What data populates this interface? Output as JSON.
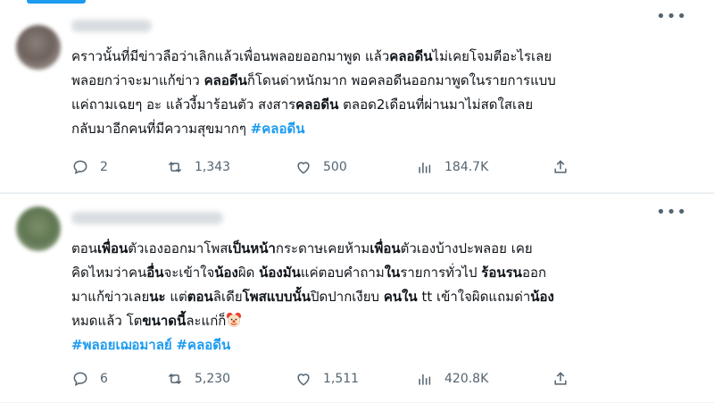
{
  "tweets": [
    {
      "text_lines": [
        [
          {
            "t": "คราวนั้นที่มีข่าวลือว่าเลิกแล้วเพื่อนพลอยออกมาพูด แล้ว"
          },
          {
            "t": "คลอดีน",
            "b": true
          },
          {
            "t": "ไม่เคยโจมตีอะไรเลย"
          }
        ],
        [
          {
            "t": "พลอยกว่าจะมาแก้ข่าว "
          },
          {
            "t": "คลอดีน",
            "b": true
          },
          {
            "t": "ก็โดนด่าหนักมาก พอคลอดีนออกมาพูดในรายการแบบ"
          }
        ],
        [
          {
            "t": "แค่ถามเฉยๆ อะ แล้วงี้มาร้อนตัว สงสาร"
          },
          {
            "t": "คลอดีน",
            "b": true
          },
          {
            "t": " ตลอด2เดือนที่ผ่านมาไม่สดใสเลย"
          }
        ],
        [
          {
            "t": "กลับมาอีกคนที่มีความสุขมากๆ "
          },
          {
            "t": "#คลอดีน",
            "h": true
          }
        ]
      ],
      "replies": "2",
      "retweets": "1,343",
      "likes": "500",
      "views": "184.7K"
    },
    {
      "text_lines": [
        [
          {
            "t": "ตอน"
          },
          {
            "t": "เพื่อน",
            "b": true
          },
          {
            "t": "ตัวเองออกมาโพส"
          },
          {
            "t": "เป็นหน้า",
            "b": true
          },
          {
            "t": "กระดาษเคยห้าม"
          },
          {
            "t": "เพื่อน",
            "b": true
          },
          {
            "t": "ตัวเองบ้างปะพลอย เคย"
          }
        ],
        [
          {
            "t": "คิดไหมว่าคน"
          },
          {
            "t": "อื่น",
            "b": true
          },
          {
            "t": "จะเข้าใจ"
          },
          {
            "t": "น้อง",
            "b": true
          },
          {
            "t": "ผิด "
          },
          {
            "t": "น้องมัน",
            "b": true
          },
          {
            "t": "แค่ตอบคำถาม"
          },
          {
            "t": "ใน",
            "b": true
          },
          {
            "t": "รายการทั่วไป "
          },
          {
            "t": "ร้อนรน",
            "b": true
          },
          {
            "t": "ออก"
          }
        ],
        [
          {
            "t": "มาแก้ข่าวเลย"
          },
          {
            "t": "นะ",
            "b": true
          },
          {
            "t": " แต่"
          },
          {
            "t": "ตอน",
            "b": true
          },
          {
            "t": "ลิเดีย"
          },
          {
            "t": "โพสแบบ",
            "b": true
          },
          {
            "t": "นั้น",
            "b": true
          },
          {
            "t": "ปิดปากเงียบ "
          },
          {
            "t": "คนใน",
            "b": true
          },
          {
            "t": " tt เข้าใจผิดแถมด่า"
          },
          {
            "t": "น้อง",
            "b": true
          }
        ],
        [
          {
            "t": "หมดแล้ว โต"
          },
          {
            "t": "ขนาด",
            "b": true
          },
          {
            "t": "นี้",
            "b": true
          },
          {
            "t": "ละแก่ก็"
          },
          {
            "e": "clown-face"
          }
        ],
        [
          {
            "t": "#พลอยเฌอมาลย์",
            "h": true
          },
          {
            "t": " "
          },
          {
            "t": "#คลอดีน",
            "h": true
          }
        ]
      ],
      "replies": "6",
      "retweets": "5,230",
      "likes": "1,511",
      "views": "420.8K"
    }
  ],
  "colors": {
    "accent": "#1d9bf0",
    "text": "#0f1419",
    "muted": "#536471"
  },
  "icons": [
    "more-icon",
    "reply-icon",
    "retweet-icon",
    "like-icon",
    "views-icon",
    "share-icon",
    "clown-face-emoji"
  ]
}
